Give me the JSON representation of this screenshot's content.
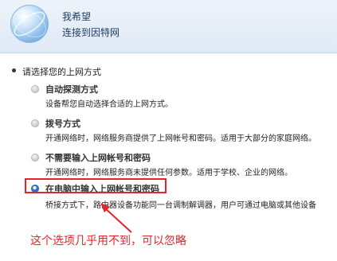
{
  "header": {
    "title": "我希望",
    "subtitle": "连接到因特网",
    "icon": "globe-icon"
  },
  "prompt": "请选择您的上网方式",
  "options": [
    {
      "title": "自动探测方式",
      "description": "设备帮您自动选择合适的上网方式。",
      "selected": false
    },
    {
      "title": "拨号方式",
      "description": "开通网络时，网络服务商提供了上网帐号和密码。适用于大部分的家庭网络。",
      "selected": false
    },
    {
      "title": "不需要输入上网帐号和密码",
      "description": "开通网络时，网络服务商未提供任何参数。适用于学校、企业的网络。",
      "selected": false
    },
    {
      "title": "在电脑中输入上网帐号和密码",
      "description": "桥接方式下，路由器设备功能同一台调制解调器，用户可通过电脑或其他设备",
      "selected": true
    }
  ],
  "annotation": "这个选项几乎用不到，可以忽略",
  "colors": {
    "annotation": "#e0262b",
    "accent": "#2f77d6",
    "header_text": "#1f3c66"
  }
}
